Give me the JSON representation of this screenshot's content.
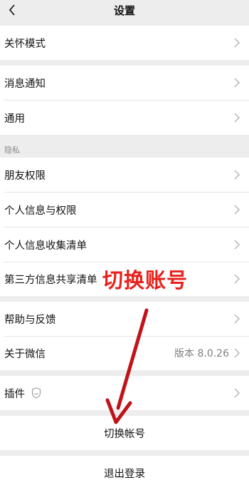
{
  "header": {
    "title": "设置",
    "back_icon": "chevron-left-icon"
  },
  "group1": {
    "items": [
      {
        "label": "关怀模式"
      }
    ]
  },
  "group2": {
    "items": [
      {
        "label": "消息通知"
      },
      {
        "label": "通用"
      }
    ]
  },
  "privacy": {
    "section_label": "隐私",
    "items": [
      {
        "label": "朋友权限"
      },
      {
        "label": "个人信息与权限"
      },
      {
        "label": "个人信息收集清单"
      },
      {
        "label": "第三方信息共享清单"
      }
    ]
  },
  "group4": {
    "items": [
      {
        "label": "帮助与反馈"
      },
      {
        "label": "关于微信",
        "value": "版本 8.0.26"
      }
    ]
  },
  "group5": {
    "items": [
      {
        "label": "插件",
        "icon": "plugin-shield-icon"
      }
    ]
  },
  "actions": {
    "switch_account": "切换帐号",
    "logout": "退出登录"
  },
  "annotation": {
    "text": "切换账号",
    "color": "#e8211c",
    "arrow_color": "#c0141a"
  },
  "colors": {
    "background": "#ededed",
    "row": "#ffffff",
    "secondary_text": "#8a8a8a"
  }
}
